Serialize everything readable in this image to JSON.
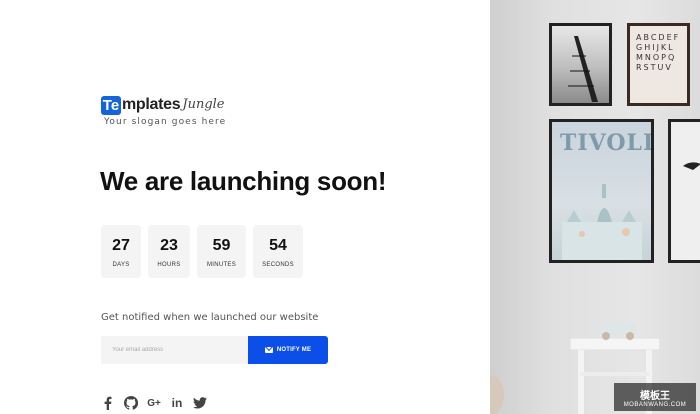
{
  "logo": {
    "box_letter": "Te",
    "text": "mplates",
    "script": "Jungle",
    "slogan": "Your slogan goes here"
  },
  "headline": "We are launching soon!",
  "countdown": [
    {
      "value": "27",
      "label": "DAYS"
    },
    {
      "value": "23",
      "label": "HOURS"
    },
    {
      "value": "59",
      "label": "MINUTES"
    },
    {
      "value": "54",
      "label": "SECONDS"
    }
  ],
  "notify": {
    "text": "Get notified when we launched our website",
    "placeholder": "Your email address",
    "button_label": "NOTIFY ME"
  },
  "socials": [
    {
      "name": "facebook-icon",
      "glyph": "f"
    },
    {
      "name": "github-icon",
      "glyph": ""
    },
    {
      "name": "google-plus-icon",
      "glyph": "G+"
    },
    {
      "name": "linkedin-icon",
      "glyph": "in"
    },
    {
      "name": "twitter-icon",
      "glyph": ""
    }
  ],
  "art": {
    "poster_title": "TIVOLI",
    "alphabet": "ABCDEFGHIJKLMNOPQRSTUV"
  },
  "watermark": {
    "title": "模板王",
    "sub": "MOBANWANG.COM"
  },
  "colors": {
    "accent": "#0b4ee8",
    "logo_blue": "#1565d8",
    "box_bg": "#f4f4f4"
  }
}
